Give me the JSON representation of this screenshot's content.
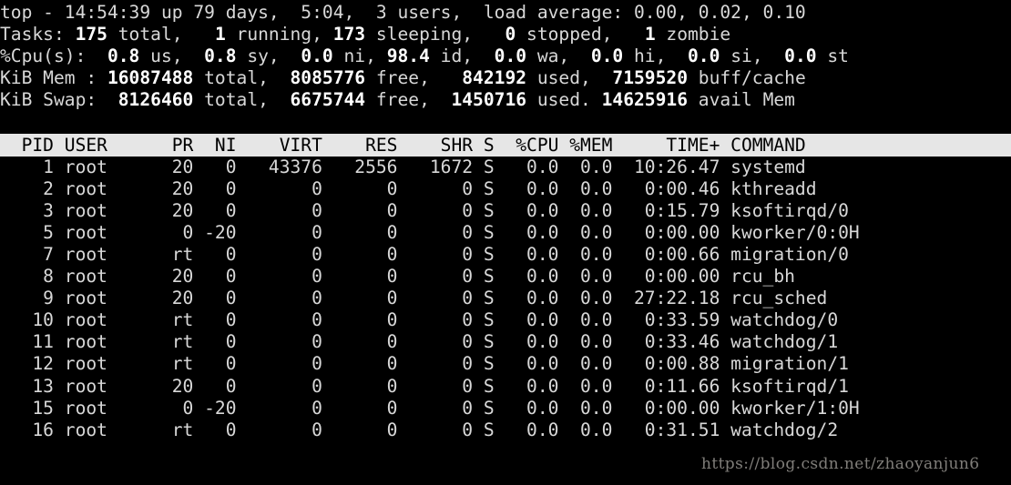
{
  "terminal": {
    "colors": {
      "background": "#000000",
      "foreground": "#d8d8d8",
      "bold_foreground": "#ffffff",
      "header_background": "#e6e6e6",
      "header_foreground": "#000000",
      "watermark": "#96948f"
    }
  },
  "summary": {
    "uptime_line": {
      "program": "top",
      "dash": "-",
      "time": "14:54:39",
      "up_label": "up",
      "uptime_days": "79 days,",
      "uptime_clock": "5:04,",
      "users_count": "3",
      "users_label": "users,",
      "load_label": "load average:",
      "load_1": "0.00,",
      "load_5": "0.02,",
      "load_15": "0.10",
      "full_text": "top - 14:54:39 up 79 days,  5:04,  3 users,  load average: 0.00, 0.02, 0.10"
    },
    "tasks_line": {
      "label": "Tasks:",
      "total": "175",
      "total_label": "total,",
      "running": "1",
      "running_label": "running,",
      "sleeping": "173",
      "sleeping_label": "sleeping,",
      "stopped": "0",
      "stopped_label": "stopped,",
      "zombie": "1",
      "zombie_label": "zombie"
    },
    "cpu_line": {
      "label": "%Cpu(s):",
      "us": "0.8",
      "us_label": "us,",
      "sy": "0.8",
      "sy_label": "sy,",
      "ni": "0.0",
      "ni_label": "ni,",
      "id": "98.4",
      "id_label": "id,",
      "wa": "0.0",
      "wa_label": "wa,",
      "hi": "0.0",
      "hi_label": "hi,",
      "si": "0.0",
      "si_label": "si,",
      "st": "0.0",
      "st_label": "st"
    },
    "mem_line": {
      "label": "KiB Mem :",
      "total": "16087488",
      "total_label": "total,",
      "free": "8085776",
      "free_label": "free,",
      "used": "842192",
      "used_label": "used,",
      "buff_cache": "7159520",
      "buff_cache_label": "buff/cache"
    },
    "swap_line": {
      "label": "KiB Swap:",
      "total": "8126460",
      "total_label": "total,",
      "free": "6675744",
      "free_label": "free,",
      "used": "1450716",
      "used_label": "used.",
      "avail": "14625916",
      "avail_label": "avail Mem"
    }
  },
  "table": {
    "header": "  PID USER      PR  NI    VIRT    RES    SHR S  %CPU %MEM     TIME+ COMMAND                  ",
    "columns": [
      "PID",
      "USER",
      "PR",
      "NI",
      "VIRT",
      "RES",
      "SHR",
      "S",
      "%CPU",
      "%MEM",
      "TIME+",
      "COMMAND"
    ],
    "rows": [
      {
        "pid": "1",
        "user": "root",
        "pr": "20",
        "ni": "0",
        "virt": "43376",
        "res": "2556",
        "shr": "1672",
        "s": "S",
        "cpu": "0.0",
        "mem": "0.0",
        "time": "10:26.47",
        "command": "systemd",
        "text": "    1 root      20   0   43376   2556   1672 S   0.0  0.0  10:26.47 systemd"
      },
      {
        "pid": "2",
        "user": "root",
        "pr": "20",
        "ni": "0",
        "virt": "0",
        "res": "0",
        "shr": "0",
        "s": "S",
        "cpu": "0.0",
        "mem": "0.0",
        "time": "0:00.46",
        "command": "kthreadd",
        "text": "    2 root      20   0       0      0      0 S   0.0  0.0   0:00.46 kthreadd"
      },
      {
        "pid": "3",
        "user": "root",
        "pr": "20",
        "ni": "0",
        "virt": "0",
        "res": "0",
        "shr": "0",
        "s": "S",
        "cpu": "0.0",
        "mem": "0.0",
        "time": "0:15.79",
        "command": "ksoftirqd/0",
        "text": "    3 root      20   0       0      0      0 S   0.0  0.0   0:15.79 ksoftirqd/0"
      },
      {
        "pid": "5",
        "user": "root",
        "pr": "0",
        "ni": "-20",
        "virt": "0",
        "res": "0",
        "shr": "0",
        "s": "S",
        "cpu": "0.0",
        "mem": "0.0",
        "time": "0:00.00",
        "command": "kworker/0:0H",
        "text": "    5 root       0 -20       0      0      0 S   0.0  0.0   0:00.00 kworker/0:0H"
      },
      {
        "pid": "7",
        "user": "root",
        "pr": "rt",
        "ni": "0",
        "virt": "0",
        "res": "0",
        "shr": "0",
        "s": "S",
        "cpu": "0.0",
        "mem": "0.0",
        "time": "0:00.66",
        "command": "migration/0",
        "text": "    7 root      rt   0       0      0      0 S   0.0  0.0   0:00.66 migration/0"
      },
      {
        "pid": "8",
        "user": "root",
        "pr": "20",
        "ni": "0",
        "virt": "0",
        "res": "0",
        "shr": "0",
        "s": "S",
        "cpu": "0.0",
        "mem": "0.0",
        "time": "0:00.00",
        "command": "rcu_bh",
        "text": "    8 root      20   0       0      0      0 S   0.0  0.0   0:00.00 rcu_bh"
      },
      {
        "pid": "9",
        "user": "root",
        "pr": "20",
        "ni": "0",
        "virt": "0",
        "res": "0",
        "shr": "0",
        "s": "S",
        "cpu": "0.0",
        "mem": "0.0",
        "time": "27:22.18",
        "command": "rcu_sched",
        "text": "    9 root      20   0       0      0      0 S   0.0  0.0  27:22.18 rcu_sched"
      },
      {
        "pid": "10",
        "user": "root",
        "pr": "rt",
        "ni": "0",
        "virt": "0",
        "res": "0",
        "shr": "0",
        "s": "S",
        "cpu": "0.0",
        "mem": "0.0",
        "time": "0:33.59",
        "command": "watchdog/0",
        "text": "   10 root      rt   0       0      0      0 S   0.0  0.0   0:33.59 watchdog/0"
      },
      {
        "pid": "11",
        "user": "root",
        "pr": "rt",
        "ni": "0",
        "virt": "0",
        "res": "0",
        "shr": "0",
        "s": "S",
        "cpu": "0.0",
        "mem": "0.0",
        "time": "0:33.46",
        "command": "watchdog/1",
        "text": "   11 root      rt   0       0      0      0 S   0.0  0.0   0:33.46 watchdog/1"
      },
      {
        "pid": "12",
        "user": "root",
        "pr": "rt",
        "ni": "0",
        "virt": "0",
        "res": "0",
        "shr": "0",
        "s": "S",
        "cpu": "0.0",
        "mem": "0.0",
        "time": "0:00.88",
        "command": "migration/1",
        "text": "   12 root      rt   0       0      0      0 S   0.0  0.0   0:00.88 migration/1"
      },
      {
        "pid": "13",
        "user": "root",
        "pr": "20",
        "ni": "0",
        "virt": "0",
        "res": "0",
        "shr": "0",
        "s": "S",
        "cpu": "0.0",
        "mem": "0.0",
        "time": "0:11.66",
        "command": "ksoftirqd/1",
        "text": "   13 root      20   0       0      0      0 S   0.0  0.0   0:11.66 ksoftirqd/1"
      },
      {
        "pid": "15",
        "user": "root",
        "pr": "0",
        "ni": "-20",
        "virt": "0",
        "res": "0",
        "shr": "0",
        "s": "S",
        "cpu": "0.0",
        "mem": "0.0",
        "time": "0:00.00",
        "command": "kworker/1:0H",
        "text": "   15 root       0 -20       0      0      0 S   0.0  0.0   0:00.00 kworker/1:0H"
      },
      {
        "pid": "16",
        "user": "root",
        "pr": "rt",
        "ni": "0",
        "virt": "0",
        "res": "0",
        "shr": "0",
        "s": "S",
        "cpu": "0.0",
        "mem": "0.0",
        "time": "0:31.51",
        "command": "watchdog/2",
        "text": "   16 root      rt   0       0      0      0 S   0.0  0.0   0:31.51 watchdog/2"
      }
    ]
  },
  "watermark": {
    "text": "https://blog.csdn.net/zhaoyanjun6"
  }
}
